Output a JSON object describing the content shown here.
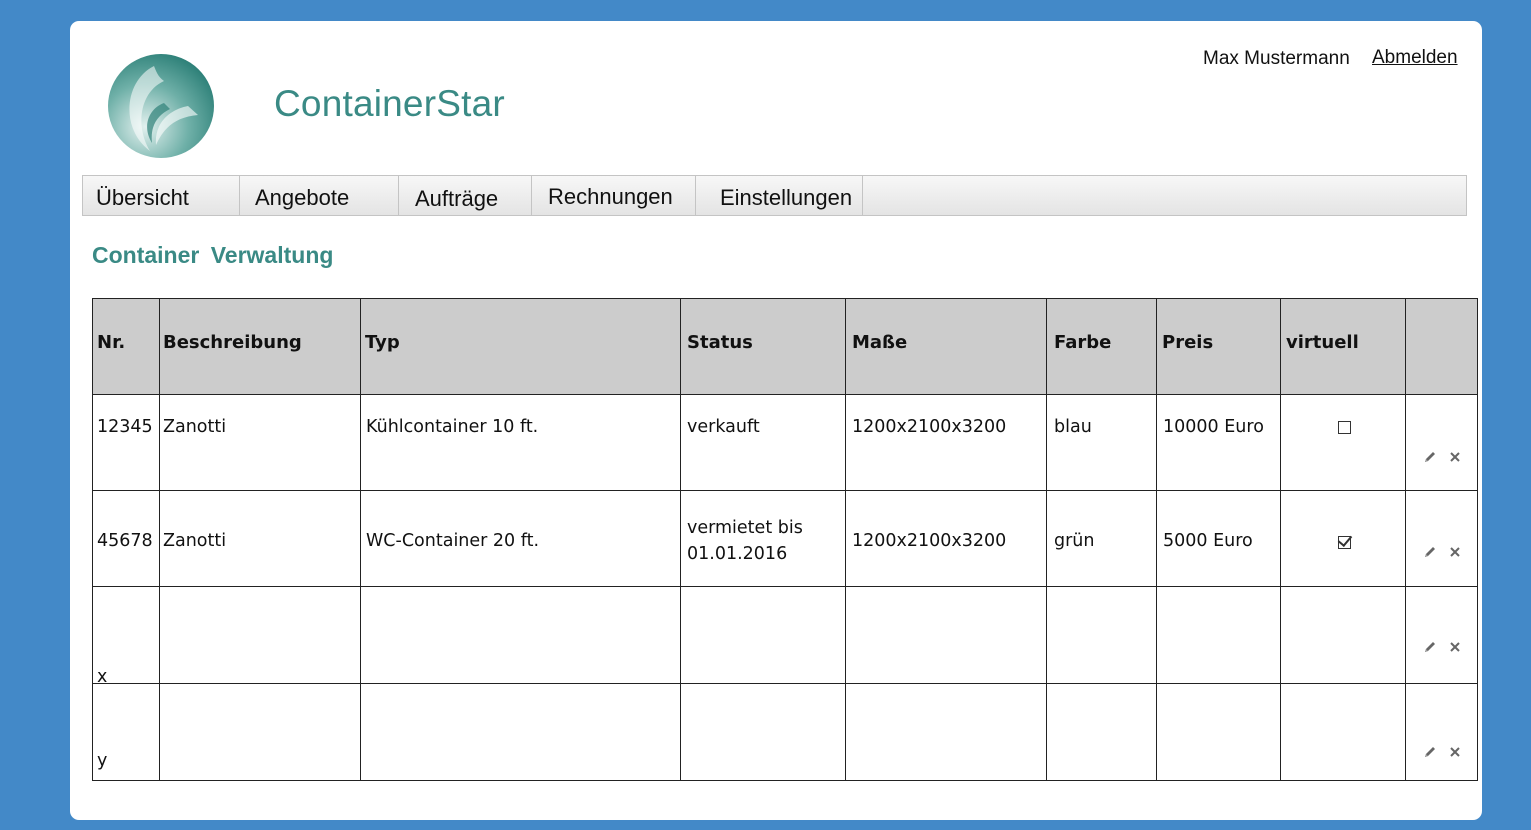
{
  "app": {
    "title": "ContainerStar",
    "logo_icon": "logo-swirl-icon",
    "accent_color": "#3a8a85",
    "background_color": "#4389c8"
  },
  "user": {
    "name": "Max Mustermann",
    "logout_label": "Abmelden"
  },
  "nav": {
    "items": [
      {
        "label": "Übersicht"
      },
      {
        "label": "Angebote"
      },
      {
        "label": "Aufträge"
      },
      {
        "label": "Rechnungen"
      },
      {
        "label": "Einstellungen"
      }
    ]
  },
  "page": {
    "section_title": "Container  Verwaltung"
  },
  "table": {
    "columns": [
      "Nr.",
      "Beschreibung",
      "Typ",
      "Status",
      "Maße",
      "Farbe",
      "Preis",
      "virtuell"
    ],
    "rows": [
      {
        "nr": "12345",
        "beschreibung": "Zanotti",
        "typ": "Kühlcontainer 10 ft.",
        "status_line1": "verkauft",
        "status_line2": "",
        "masse": "1200x2100x3200",
        "farbe": "blau",
        "preis": "10000 Euro",
        "virtuell": false
      },
      {
        "nr": "45678",
        "beschreibung": "Zanotti",
        "typ": "WC-Container 20 ft.",
        "status_line1": "vermietet bis",
        "status_line2": "01.01.2016",
        "masse": "1200x2100x3200",
        "farbe": "grün",
        "preis": "5000 Euro",
        "virtuell": true
      },
      {
        "nr": "x"
      },
      {
        "nr": "y"
      }
    ],
    "row_actions": [
      "pencil-icon",
      "close-icon"
    ]
  }
}
